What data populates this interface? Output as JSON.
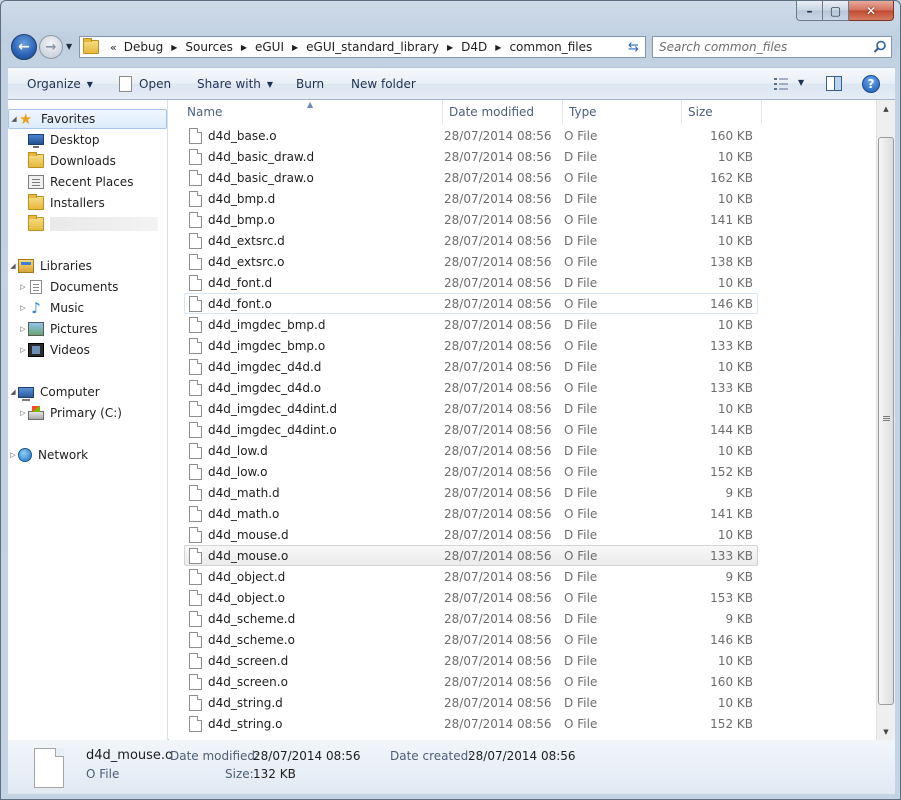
{
  "window": {
    "close_label": "✕",
    "min_label": "–",
    "max_label": "▢"
  },
  "address": {
    "overflow": "«",
    "crumbs": [
      "Debug",
      "Sources",
      "eGUI",
      "eGUI_standard_library",
      "D4D",
      "common_files"
    ]
  },
  "search": {
    "placeholder": "Search common_files"
  },
  "toolbar": {
    "organize": "Organize",
    "open": "Open",
    "share_with": "Share with",
    "burn": "Burn",
    "new_folder": "New folder",
    "help": "?"
  },
  "nav": {
    "favorites": "Favorites",
    "desktop": "Desktop",
    "downloads": "Downloads",
    "recent_places": "Recent Places",
    "installers": "Installers",
    "libraries": "Libraries",
    "documents": "Documents",
    "music": "Music",
    "pictures": "Pictures",
    "videos": "Videos",
    "computer": "Computer",
    "primary_c": "Primary (C:)",
    "network": "Network"
  },
  "columns": {
    "name": "Name",
    "date": "Date modified",
    "type": "Type",
    "size": "Size"
  },
  "files": [
    {
      "name": "d4d_base.o",
      "date": "28/07/2014 08:56",
      "type": "O File",
      "size": "160 KB"
    },
    {
      "name": "d4d_basic_draw.d",
      "date": "28/07/2014 08:56",
      "type": "D File",
      "size": "10 KB"
    },
    {
      "name": "d4d_basic_draw.o",
      "date": "28/07/2014 08:56",
      "type": "O File",
      "size": "162 KB"
    },
    {
      "name": "d4d_bmp.d",
      "date": "28/07/2014 08:56",
      "type": "D File",
      "size": "10 KB"
    },
    {
      "name": "d4d_bmp.o",
      "date": "28/07/2014 08:56",
      "type": "O File",
      "size": "141 KB"
    },
    {
      "name": "d4d_extsrc.d",
      "date": "28/07/2014 08:56",
      "type": "D File",
      "size": "10 KB"
    },
    {
      "name": "d4d_extsrc.o",
      "date": "28/07/2014 08:56",
      "type": "O File",
      "size": "138 KB"
    },
    {
      "name": "d4d_font.d",
      "date": "28/07/2014 08:56",
      "type": "D File",
      "size": "10 KB"
    },
    {
      "name": "d4d_font.o",
      "date": "28/07/2014 08:56",
      "type": "O File",
      "size": "146 KB"
    },
    {
      "name": "d4d_imgdec_bmp.d",
      "date": "28/07/2014 08:56",
      "type": "D File",
      "size": "10 KB"
    },
    {
      "name": "d4d_imgdec_bmp.o",
      "date": "28/07/2014 08:56",
      "type": "O File",
      "size": "133 KB"
    },
    {
      "name": "d4d_imgdec_d4d.d",
      "date": "28/07/2014 08:56",
      "type": "D File",
      "size": "10 KB"
    },
    {
      "name": "d4d_imgdec_d4d.o",
      "date": "28/07/2014 08:56",
      "type": "O File",
      "size": "133 KB"
    },
    {
      "name": "d4d_imgdec_d4dint.d",
      "date": "28/07/2014 08:56",
      "type": "D File",
      "size": "10 KB"
    },
    {
      "name": "d4d_imgdec_d4dint.o",
      "date": "28/07/2014 08:56",
      "type": "O File",
      "size": "144 KB"
    },
    {
      "name": "d4d_low.d",
      "date": "28/07/2014 08:56",
      "type": "D File",
      "size": "10 KB"
    },
    {
      "name": "d4d_low.o",
      "date": "28/07/2014 08:56",
      "type": "O File",
      "size": "152 KB"
    },
    {
      "name": "d4d_math.d",
      "date": "28/07/2014 08:56",
      "type": "D File",
      "size": "9 KB"
    },
    {
      "name": "d4d_math.o",
      "date": "28/07/2014 08:56",
      "type": "O File",
      "size": "141 KB"
    },
    {
      "name": "d4d_mouse.d",
      "date": "28/07/2014 08:56",
      "type": "D File",
      "size": "10 KB"
    },
    {
      "name": "d4d_mouse.o",
      "date": "28/07/2014 08:56",
      "type": "O File",
      "size": "133 KB"
    },
    {
      "name": "d4d_object.d",
      "date": "28/07/2014 08:56",
      "type": "D File",
      "size": "9 KB"
    },
    {
      "name": "d4d_object.o",
      "date": "28/07/2014 08:56",
      "type": "O File",
      "size": "153 KB"
    },
    {
      "name": "d4d_scheme.d",
      "date": "28/07/2014 08:56",
      "type": "D File",
      "size": "9 KB"
    },
    {
      "name": "d4d_scheme.o",
      "date": "28/07/2014 08:56",
      "type": "O File",
      "size": "146 KB"
    },
    {
      "name": "d4d_screen.d",
      "date": "28/07/2014 08:56",
      "type": "D File",
      "size": "10 KB"
    },
    {
      "name": "d4d_screen.o",
      "date": "28/07/2014 08:56",
      "type": "O File",
      "size": "160 KB"
    },
    {
      "name": "d4d_string.d",
      "date": "28/07/2014 08:56",
      "type": "D File",
      "size": "10 KB"
    },
    {
      "name": "d4d_string.o",
      "date": "28/07/2014 08:56",
      "type": "O File",
      "size": "152 KB"
    }
  ],
  "details": {
    "name": "d4d_mouse.o",
    "type": "O File",
    "modified_label": "Date modified:",
    "modified": "28/07/2014 08:56",
    "created_label": "Date created:",
    "created": "28/07/2014 08:56",
    "size_label": "Size:",
    "size": "132 KB"
  }
}
